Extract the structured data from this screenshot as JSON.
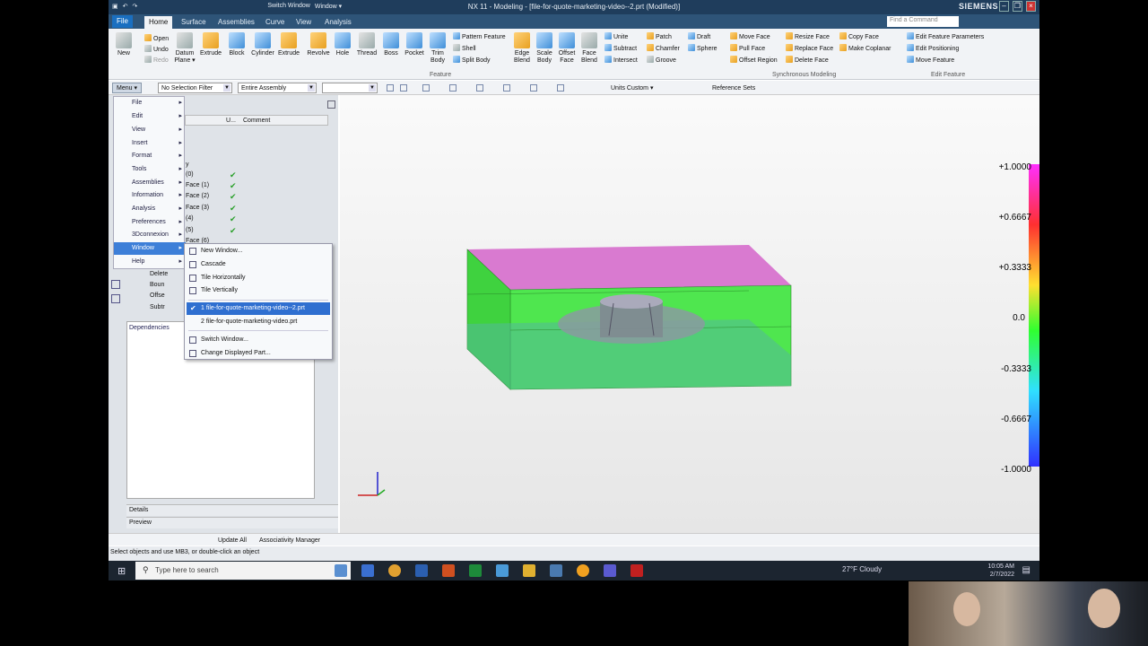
{
  "window": {
    "title": "NX 11 - Modeling - [file-for-quote-marketing-video--2.prt (Modified)]",
    "brand": "SIEMENS",
    "qat_switch": "Switch Window",
    "qat_window": "Window ▾"
  },
  "tabs": [
    "File",
    "Home",
    "Surface",
    "Assemblies",
    "Curve",
    "View",
    "Analysis"
  ],
  "find_command": "Find a Command",
  "ribbon": {
    "open": "Open",
    "undo": "Undo",
    "redo": "Redo",
    "new": "New",
    "big": [
      "Datum Plane ▾",
      "Extrude",
      "Block",
      "Cylinder",
      "Extrude",
      "Revolve",
      "Hole",
      "Thread",
      "Boss",
      "Pocket",
      "Trim Body",
      "Edge Blend",
      "Scale Body",
      "Offset Face",
      "Face Blend"
    ],
    "feature_small": [
      "Pattern Feature",
      "Shell",
      "Split Body"
    ],
    "feature_label": "Feature",
    "combine": [
      "Unite",
      "Subtract",
      "Intersect"
    ],
    "misc": [
      "Patch",
      "Chamfer",
      "Groove",
      "Draft",
      "Sphere"
    ],
    "sync": [
      "Move Face",
      "Pull Face",
      "Offset Region",
      "Resize Face",
      "Replace Face",
      "Delete Face",
      "Copy Face",
      "Make Coplanar"
    ],
    "sync_label": "Synchronous Modeling",
    "edit": [
      "Edit Feature Parameters",
      "Edit Positioning",
      "Move Feature"
    ],
    "edit_label": "Edit Feature"
  },
  "selbar": {
    "menu": "Menu ▾",
    "filter": "No Selection Filter",
    "scope": "Entire Assembly",
    "units": "Units Custom ▾",
    "refsets": "Reference Sets"
  },
  "nav": {
    "col_u": "U...",
    "col_comment": "Comment",
    "rows": [
      "y",
      "(0)",
      "Face (1)",
      "Face (2)",
      "Face (3)",
      "(4)",
      "(5)",
      "Face (6)"
    ],
    "lower": [
      "Delete",
      "Boun",
      "Offse",
      "Subtr"
    ]
  },
  "panels": {
    "dependencies": "Dependencies",
    "details": "Details",
    "preview": "Preview"
  },
  "menu": {
    "items": [
      "File",
      "Edit",
      "View",
      "Insert",
      "Format",
      "Tools",
      "Assemblies",
      "Information",
      "Analysis",
      "Preferences",
      "3Dconnexion",
      "Window",
      "Help"
    ]
  },
  "submenu": {
    "items": [
      "New Window...",
      "Cascade",
      "Tile Horizontally",
      "Tile Vertically",
      "1 file-for-quote-marketing-video--2.prt",
      "2 file-for-quote-marketing-video.prt",
      "Switch Window...",
      "Change Displayed Part..."
    ]
  },
  "legend": [
    "+1.0000",
    "+0.6667",
    "+0.3333",
    "0.0",
    "-0.3333",
    "-0.6667",
    "-1.0000"
  ],
  "bottombar": {
    "update": "Update All",
    "assoc": "Associativity Manager"
  },
  "status": "Select objects and use MB3, or double-click an object",
  "taskbar": {
    "search": "Type here to search",
    "weather": "27°F  Cloudy",
    "time": "10:05 AM",
    "date": "2/7/2022"
  },
  "colors": {
    "titlebar": "#1f3d5c",
    "tab_active": "#f1f3f6",
    "highlight": "#2f6fd0",
    "model_green": "#44e044",
    "model_top": "#d97ad0"
  }
}
